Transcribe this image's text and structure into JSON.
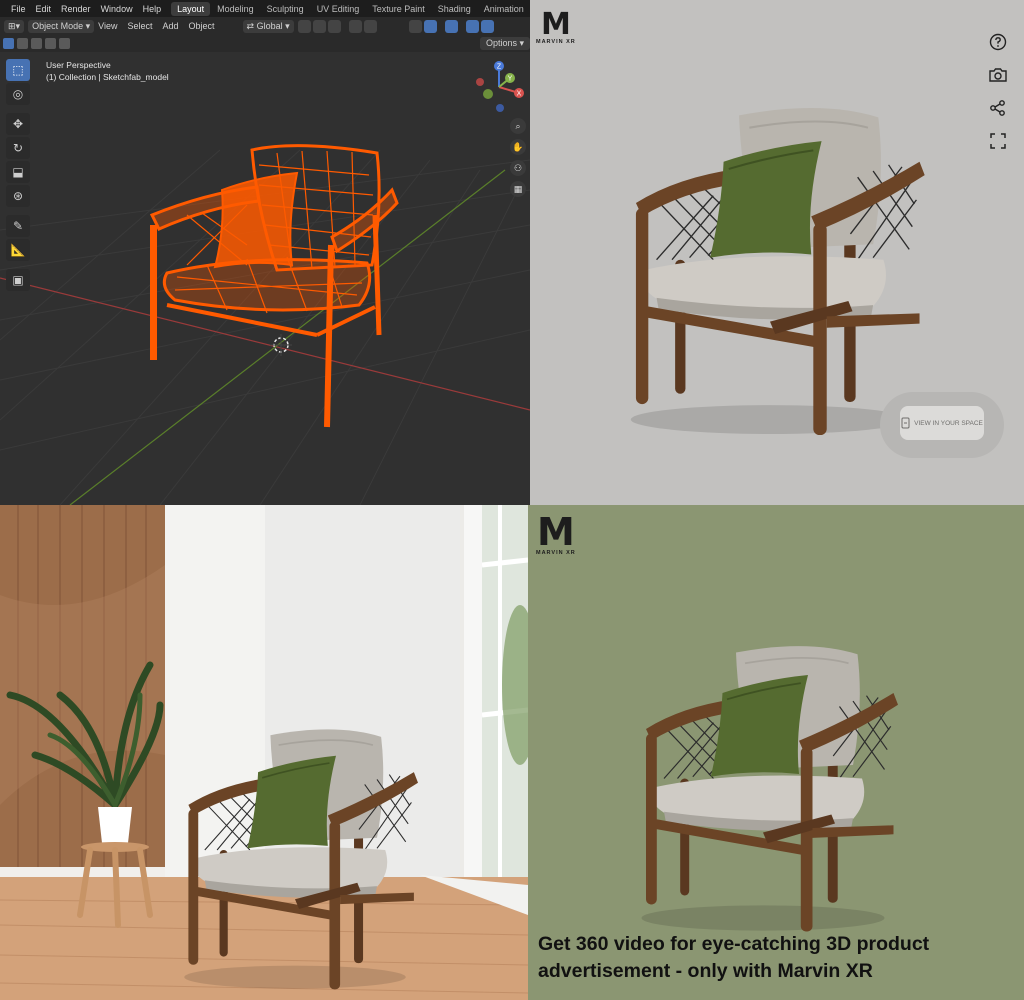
{
  "blender": {
    "menu": [
      "File",
      "Edit",
      "Render",
      "Window",
      "Help"
    ],
    "workspace_tabs": [
      {
        "label": "Layout",
        "active": true
      },
      {
        "label": "Modeling",
        "active": false
      },
      {
        "label": "Sculpting",
        "active": false
      },
      {
        "label": "UV Editing",
        "active": false
      },
      {
        "label": "Texture Paint",
        "active": false
      },
      {
        "label": "Shading",
        "active": false
      },
      {
        "label": "Animation",
        "active": false
      }
    ],
    "header": {
      "mode": "Object Mode",
      "menus": [
        "View",
        "Select",
        "Add",
        "Object"
      ],
      "transform_orientation": "Global",
      "options_label": "Options"
    },
    "viewport": {
      "view_name": "User Perspective",
      "collection_line": "(1) Collection | Sketchfab_model"
    },
    "gizmo": {
      "x": "X",
      "y": "Y",
      "z": "Z"
    },
    "colors": {
      "wireframe": "#ff5a00",
      "active_tool": "#4772b3",
      "x_axis": "#c0392b",
      "y_axis": "#6c9a2d"
    }
  },
  "viewer": {
    "logo_letter": "M",
    "logo_text": "MARVIN XR",
    "icons": [
      "help-icon",
      "camera-icon",
      "share-icon",
      "fullscreen-icon"
    ],
    "ar_button_label": "VIEW IN YOUR SPACE",
    "background": "#c2c1bf"
  },
  "ad": {
    "logo_letter": "M",
    "logo_text": "MARVIN XR",
    "headline_line1": "Get 360 video for eye-catching 3D product",
    "headline_line2": "advertisement - only with Marvin XR",
    "background": "#8b9672"
  }
}
